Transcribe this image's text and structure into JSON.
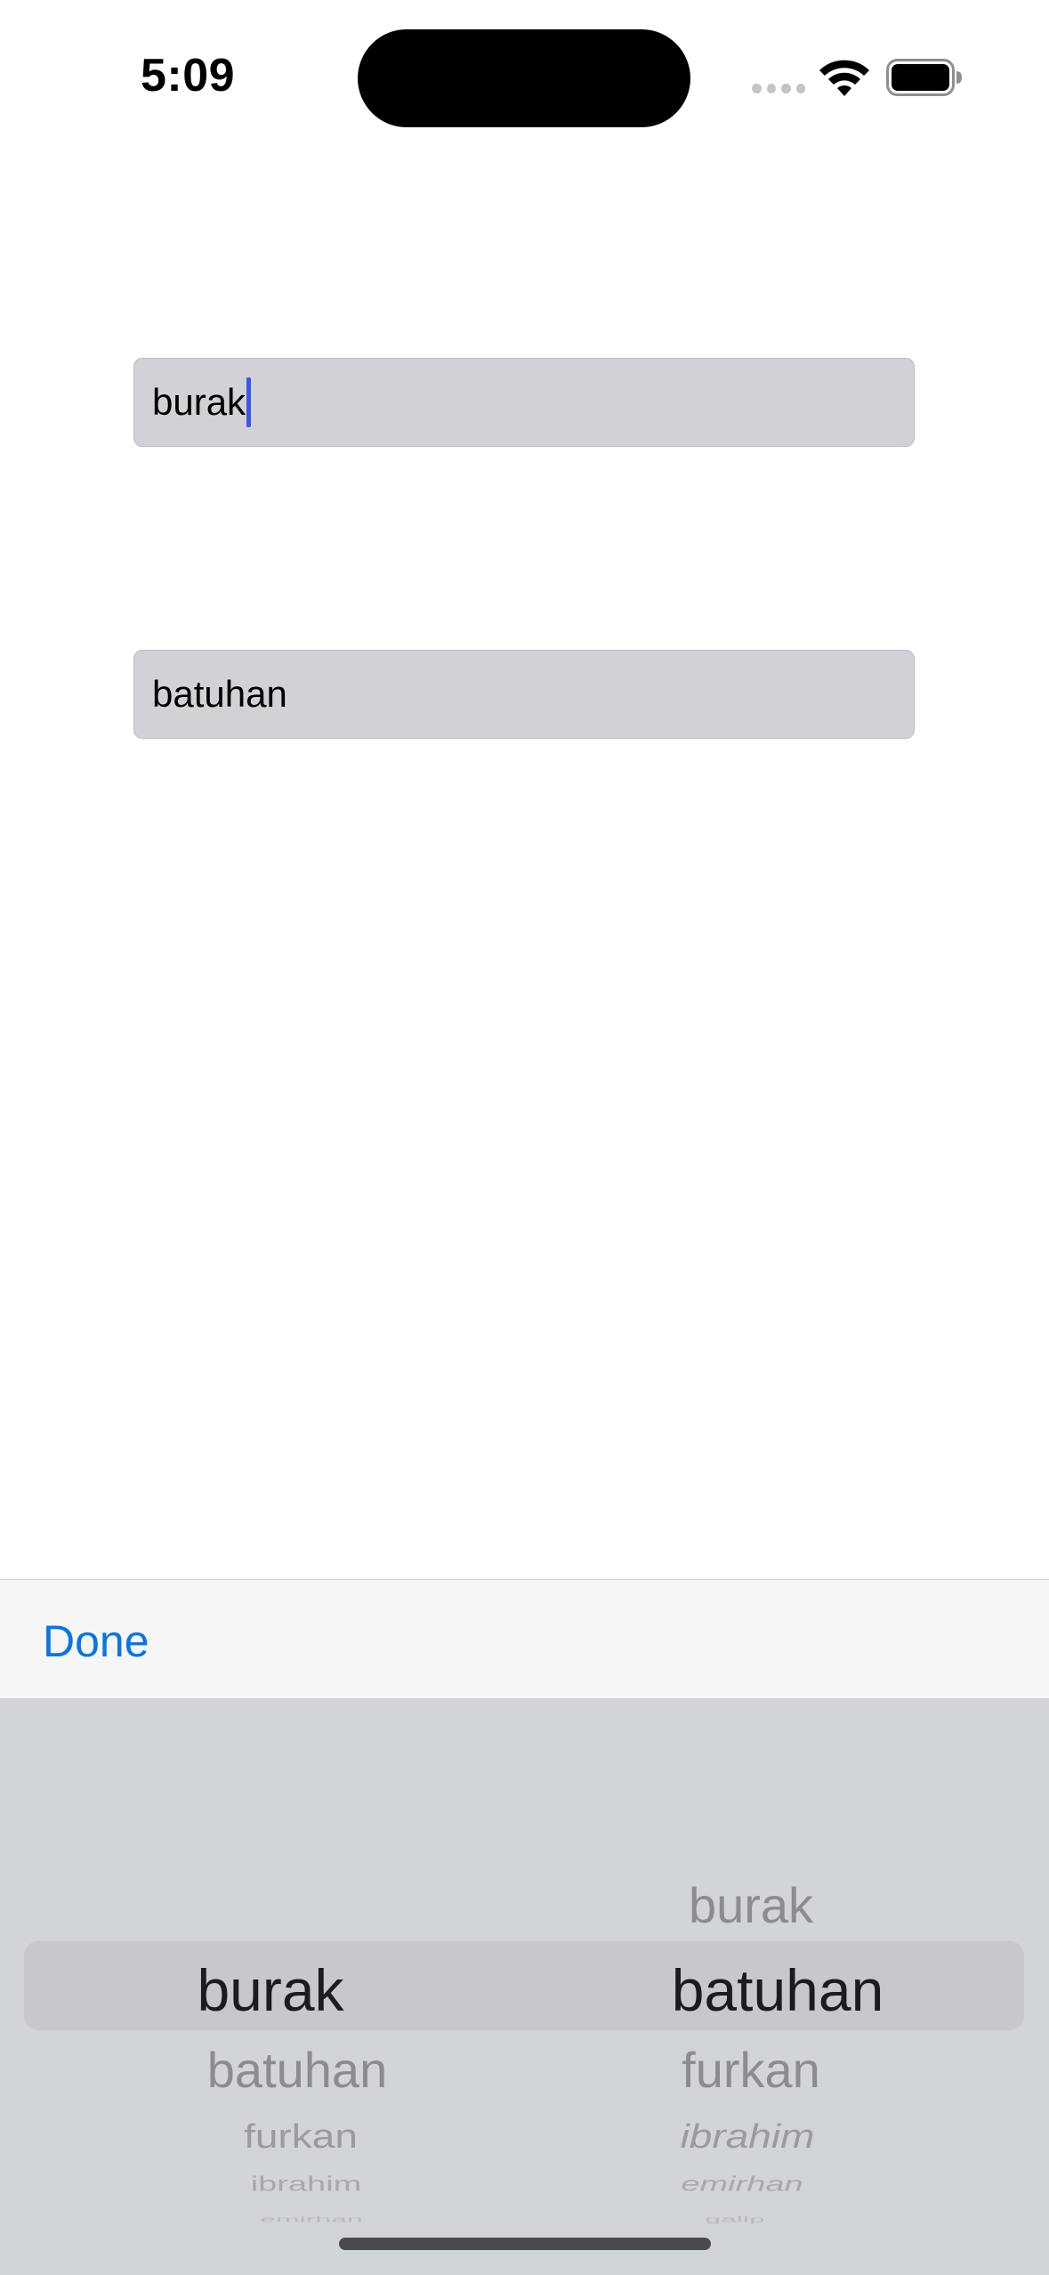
{
  "status_bar": {
    "time": "5:09"
  },
  "fields": [
    {
      "value": "burak"
    },
    {
      "value": "batuhan"
    }
  ],
  "toolbar": {
    "done_label": "Done"
  },
  "picker": {
    "left_column": {
      "selected": "burak",
      "below": [
        "batuhan",
        "furkan",
        "ibrahim",
        "emirhan"
      ]
    },
    "right_column": {
      "above": [
        "burak"
      ],
      "selected": "batuhan",
      "below": [
        "furkan",
        "ibrahim",
        "emirhan",
        "galip"
      ]
    }
  }
}
